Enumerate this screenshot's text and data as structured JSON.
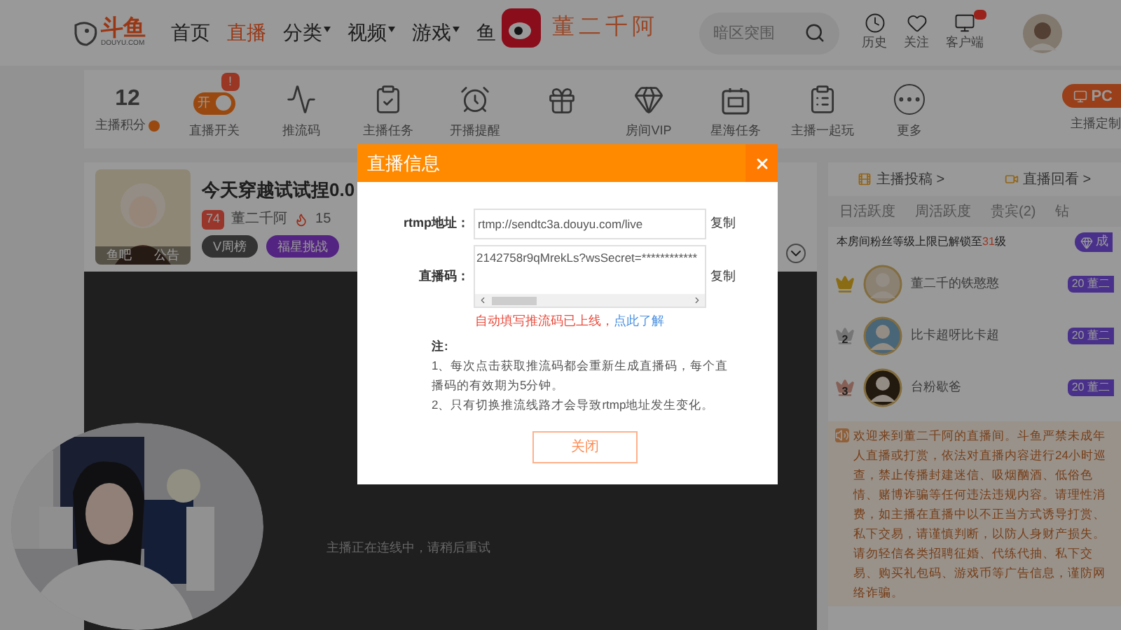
{
  "header": {
    "logo": {
      "name": "斗鱼",
      "sub": "DOUYU.COM"
    },
    "nav": [
      {
        "label": "首页",
        "selected": false,
        "dropdown": false
      },
      {
        "label": "直播",
        "selected": true,
        "dropdown": false
      },
      {
        "label": "分类",
        "selected": false,
        "dropdown": true
      },
      {
        "label": "视频",
        "selected": false,
        "dropdown": true
      },
      {
        "label": "游戏",
        "selected": false,
        "dropdown": true
      },
      {
        "label": "鱼",
        "selected": false,
        "dropdown": false
      }
    ],
    "search": {
      "placeholder": "暗区突围"
    },
    "icons": [
      {
        "kind": "clock",
        "label": "历史"
      },
      {
        "kind": "heart",
        "label": "关注"
      },
      {
        "kind": "client",
        "label": "客户端",
        "badge": true
      }
    ]
  },
  "stream_overlay": {
    "name": "董二千阿"
  },
  "toolbar": {
    "score": {
      "value": "12",
      "label": "主播积分"
    },
    "items": [
      {
        "kind": "switch",
        "label": "直播开关",
        "switch_text": "开",
        "on": true,
        "alert": "!"
      },
      {
        "kind": "wave",
        "label": "推流码"
      },
      {
        "kind": "task",
        "label": "主播任务"
      },
      {
        "kind": "alarm",
        "label": "开播提醒"
      },
      {
        "kind": "gift"
      },
      {
        "kind": "vip",
        "label": "房间VIP"
      },
      {
        "kind": "ad",
        "label": "星海任务"
      },
      {
        "kind": "clipboard",
        "label": "主播一起玩"
      },
      {
        "kind": "more",
        "label": "更多"
      }
    ],
    "pc_button": "PC",
    "pc_label": "主播定制"
  },
  "streamer": {
    "title": "今天穿越试试捏0.0",
    "level": "74",
    "name": "董二千阿",
    "hot": "15",
    "avatar_tags": [
      "鱼吧",
      "公告"
    ],
    "chips": [
      "V周榜",
      "福星挑战"
    ]
  },
  "video": {
    "message": "主播正在连线中，请稍后重试"
  },
  "side": {
    "links": [
      "主播投稿 >",
      "直播回看 >"
    ],
    "tabs": [
      {
        "label": "日活跃度"
      },
      {
        "label": "周活跃度"
      },
      {
        "label": "贵宾(2)"
      },
      {
        "label": "钻"
      }
    ],
    "fan_notice": {
      "before": "本房间粉丝等级上限已解锁至",
      "highlight": "31",
      "after": "级"
    },
    "become_button": "成",
    "ranking": [
      {
        "name": "董二千的铁憨憨",
        "badge_level": "20",
        "badge_name": "董二"
      },
      {
        "rank": "2",
        "name": "比卡超呀比卡超",
        "badge_level": "20",
        "badge_name": "董二"
      },
      {
        "rank": "3",
        "name": "台粉歇爸",
        "badge_level": "20",
        "badge_name": "董二"
      }
    ],
    "notice": "欢迎来到董二千阿的直播间。斗鱼严禁未成年人直播或打赏，依法对直播内容进行24小时巡查，禁止传播封建迷信、吸烟酗酒、低俗色情、赌博诈骗等任何违法违规内容。请理性消费，如主播在直播中以不正当方式诱导打赏、私下交易，请谨慎判断，以防人身财产损失。请勿轻信各类招聘征婚、代练代抽、私下交易、购买礼包码、游戏币等广告信息，谨防网络诈骗。"
  },
  "dialog": {
    "title": "直播信息",
    "fields": [
      {
        "label": "rtmp地址：",
        "value": "rtmp://sendtc3a.douyu.com/live",
        "copy": "复制",
        "multiline": false
      },
      {
        "label": "直播码：",
        "value": "2142758r9qMrekLs?wsSecret=************",
        "copy": "复制",
        "multiline": true
      }
    ],
    "hint": "自动填写推流码已上线，",
    "hint_link": "点此了解",
    "note_title": "注:",
    "notes": [
      "1、每次点击获取推流码都会重新生成直播码，每个直播码的有效期为5分钟。",
      "2、只有切换推流线路才会导致rtmp地址发生变化。"
    ],
    "close_button": "关闭"
  }
}
